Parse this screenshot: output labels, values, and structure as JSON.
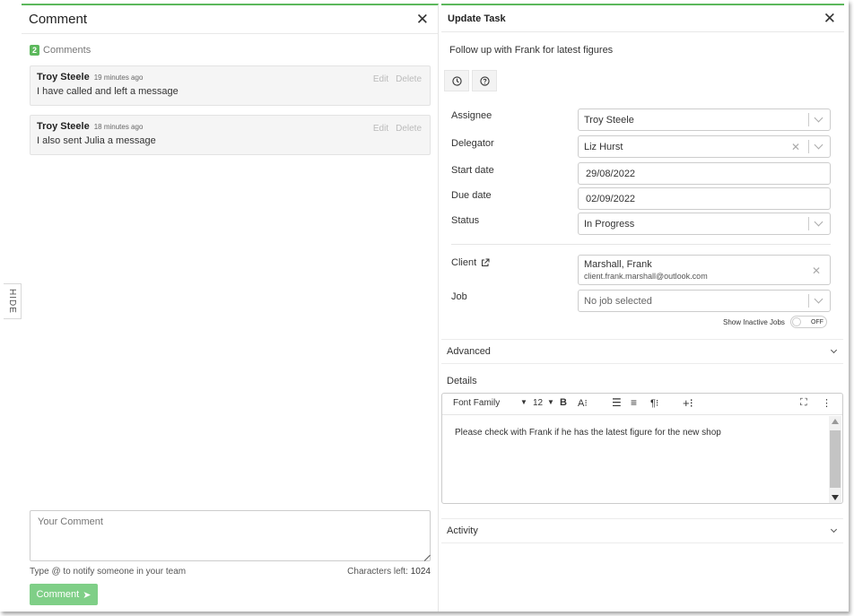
{
  "hide_tab": {
    "label": "HIDE"
  },
  "comment_panel": {
    "title": "Comment",
    "count": "2",
    "count_label": "Comments",
    "comments": [
      {
        "author": "Troy Steele",
        "time": "19 minutes ago",
        "text": "I have called and left a message",
        "edit": "Edit",
        "delete": "Delete"
      },
      {
        "author": "Troy Steele",
        "time": "18 minutes ago",
        "text": "I also sent Julia a message",
        "edit": "Edit",
        "delete": "Delete"
      }
    ],
    "input_placeholder": "Your Comment",
    "hint": "Type @ to notify someone in your team",
    "chars_left_label": "Characters left:",
    "chars_left": "1024",
    "submit_label": "Comment",
    "accent_color": "#5cb85c"
  },
  "task_panel": {
    "title": "Update Task",
    "task_title": "Follow up with Frank for latest figures",
    "icons": [
      "clock-icon",
      "help-icon"
    ],
    "fields": {
      "assignee": {
        "label": "Assignee",
        "value": "Troy Steele"
      },
      "delegator": {
        "label": "Delegator",
        "value": "Liz Hurst"
      },
      "start_date": {
        "label": "Start date",
        "value": "29/08/2022"
      },
      "due_date": {
        "label": "Due date",
        "value": "02/09/2022"
      },
      "status": {
        "label": "Status",
        "value": "In Progress"
      },
      "client": {
        "label": "Client",
        "name": "Marshall, Frank",
        "email": "client.frank.marshall@outlook.com"
      },
      "job": {
        "label": "Job",
        "placeholder": "No job selected"
      }
    },
    "show_inactive": {
      "label": "Show Inactive Jobs",
      "state": "OFF"
    },
    "advanced_label": "Advanced",
    "details_label": "Details",
    "editor": {
      "font_family": "Font Family",
      "font_size": "12",
      "bold": "B",
      "body": "Please check with Frank if he has the latest figure for the new shop"
    },
    "activity_label": "Activity"
  }
}
